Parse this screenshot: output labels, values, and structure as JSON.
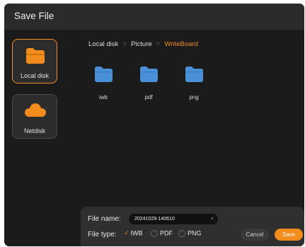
{
  "dialog": {
    "title": "Save File"
  },
  "sidebar": {
    "items": [
      {
        "label": "Local disk",
        "icon": "folder-icon",
        "active": true
      },
      {
        "label": "Netdisk",
        "icon": "cloud-icon",
        "active": false
      }
    ]
  },
  "breadcrumb": {
    "items": [
      {
        "label": "Local disk"
      },
      {
        "label": "Picture"
      },
      {
        "label": "WriteBoard",
        "current": true
      }
    ],
    "separator": ">"
  },
  "folders": [
    {
      "name": "iwb",
      "icon": "folder-icon"
    },
    {
      "name": "pdf",
      "icon": "folder-icon"
    },
    {
      "name": "png",
      "icon": "folder-icon"
    }
  ],
  "footer": {
    "file_name_label": "File name:",
    "file_name_value": "20241029-140610",
    "clear_glyph": "×",
    "file_type_label": "File type:",
    "file_types": [
      {
        "label": "IWB",
        "selected": true
      },
      {
        "label": "PDF",
        "selected": false
      },
      {
        "label": "PNG",
        "selected": false
      }
    ],
    "cancel_label": "Cancel",
    "save_label": "Save"
  },
  "colors": {
    "accent": "#f28c1c",
    "folder_blue": "#4a90d9",
    "dialog_bg": "#1b1b1c",
    "titlebar_bg": "#2b2b2c"
  }
}
